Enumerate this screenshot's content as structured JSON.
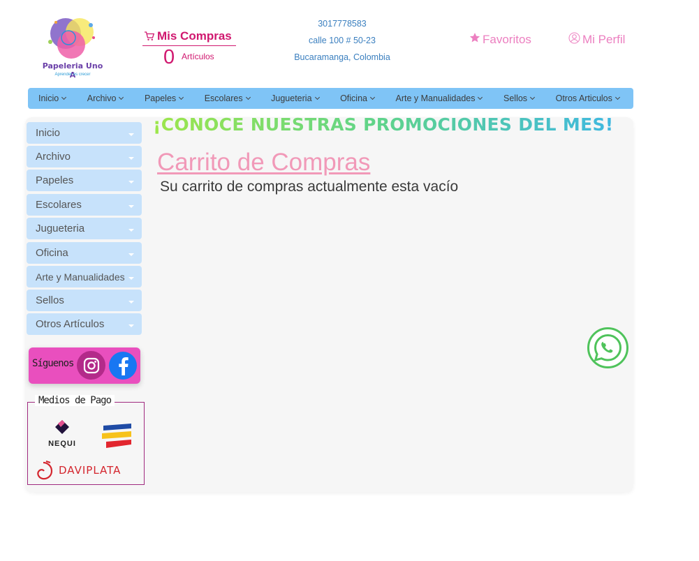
{
  "header": {
    "logo_text": "Papeleria Uno A",
    "logo_tagline": "Aprender es crecer",
    "cart": {
      "title": "Mis Compras",
      "count": "0",
      "articles_label": "Artículos",
      "icon": "cart-icon"
    },
    "contact": {
      "phone": "3017778583",
      "address": "calle 100 # 50-23",
      "city": "Bucaramanga, Colombia"
    },
    "favorites": {
      "label": "Favoritos",
      "icon": "star-icon"
    },
    "profile": {
      "label": "Mi Perfil",
      "icon": "user-icon"
    }
  },
  "nav": {
    "items": [
      {
        "label": "Inicio"
      },
      {
        "label": "Archivo"
      },
      {
        "label": "Papeles"
      },
      {
        "label": "Escolares"
      },
      {
        "label": "Jugueteria"
      },
      {
        "label": "Oficina"
      },
      {
        "label": "Arte y Manualidades"
      },
      {
        "label": "Sellos"
      },
      {
        "label": "Otros Articulos"
      }
    ]
  },
  "sidebar": {
    "items": [
      {
        "label": "Inicio"
      },
      {
        "label": "Archivo"
      },
      {
        "label": "Papeles"
      },
      {
        "label": "Escolares"
      },
      {
        "label": "Jugueteria"
      },
      {
        "label": "Oficina"
      },
      {
        "label": "Arte y Manualidades"
      },
      {
        "label": "Sellos"
      },
      {
        "label": "Otros Artículos"
      }
    ],
    "social": {
      "label": "Síguenos",
      "icons": [
        "instagram-icon",
        "facebook-icon"
      ]
    },
    "payment": {
      "legend": "Medios de Pago",
      "nequi_label": "NEQUI",
      "daviplata_label": "DAVIPLATA"
    }
  },
  "main": {
    "promo_banner": "¡CONOCE NUESTRAS PROMOCIONES DEL MES!",
    "cart_heading": "Carrito de Compras",
    "empty_message": "Su carrito de compras actualmente esta vacío"
  },
  "colors": {
    "accent_pink": "#d0186f",
    "nav_blue": "#7fc4f6",
    "sidebar_blue": "#c7e2fb",
    "social_pink": "#e94fbe",
    "whatsapp_green": "#4fc35b"
  }
}
